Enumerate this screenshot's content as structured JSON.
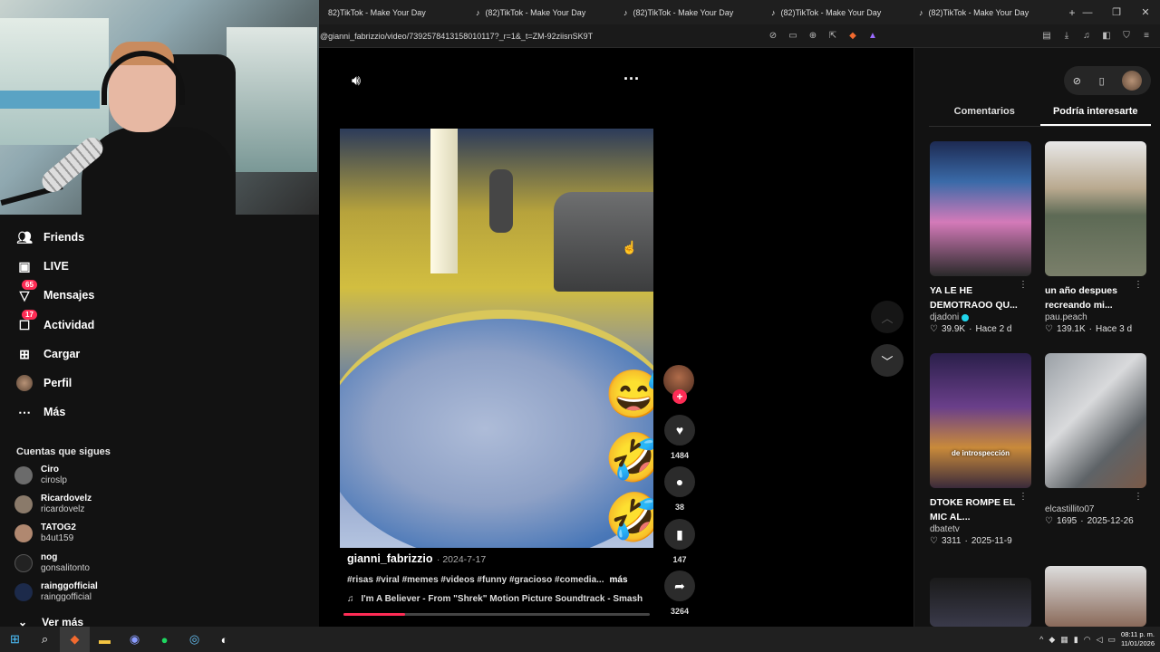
{
  "browser": {
    "tabs": [
      {
        "title": "(82)TikTok - Make Your Day",
        "display": "82)TikTok - Make Your Day"
      },
      {
        "title": "(82)TikTok - Make Your Day",
        "display": "(82)TikTok - Make Your Day"
      },
      {
        "title": "(82)TikTok - Make Your Day",
        "display": "(82)TikTok - Make Your Day"
      },
      {
        "title": "(82)TikTok - Make Your Day",
        "display": "(82)TikTok - Make Your Day"
      },
      {
        "title": "(82)TikTok - Make Your Day",
        "display": "(82)TikTok - Make Your Day"
      }
    ],
    "new_tab": "+",
    "url": "@gianni_fabrizzio/video/7392578413158010117?_r=1&_t=ZM-92ziisnSK9T"
  },
  "sidebar": {
    "items": [
      {
        "label": "Friends",
        "icon": "friends-icon",
        "badge": ""
      },
      {
        "label": "LIVE",
        "icon": "live-icon",
        "badge": ""
      },
      {
        "label": "Mensajes",
        "icon": "messages-icon",
        "badge": "65"
      },
      {
        "label": "Actividad",
        "icon": "activity-icon",
        "badge": "17"
      },
      {
        "label": "Cargar",
        "icon": "upload-icon",
        "badge": ""
      },
      {
        "label": "Perfil",
        "icon": "profile-avatar",
        "badge": ""
      },
      {
        "label": "Más",
        "icon": "more-icon",
        "badge": ""
      }
    ],
    "following_title": "Cuentas que sigues",
    "accounts": [
      {
        "name": "Ciro",
        "handle": "ciroslp",
        "color": "#6b6b6b"
      },
      {
        "name": "Ricardovelz",
        "handle": "ricardovelz",
        "color": "#8a7a6a"
      },
      {
        "name": "TATOG2",
        "handle": "b4ut159",
        "color": "#b08870"
      },
      {
        "name": "nog",
        "handle": "gonsalitonto",
        "color": "#222222"
      },
      {
        "name": "rainggofficial",
        "handle": "rainggofficial",
        "color": "#1c2a4a"
      }
    ],
    "see_more": "Ver más"
  },
  "video": {
    "username": "gianni_fabrizzio",
    "date": "· 2024-7-17",
    "hashtags": "#risas #viral #memes #videos #funny #gracioso #comedia...",
    "more": "más",
    "music": "I'm A Believer - From \"Shrek\" Motion Picture Soundtrack - Smash",
    "progress": 0.2,
    "likes": "1484",
    "comments": "38",
    "saves": "147",
    "shares": "3264",
    "emojis": [
      "😅",
      "🤣",
      "🤣"
    ]
  },
  "right_panel": {
    "tabs": [
      "Comentarios",
      "Podría interesarte"
    ],
    "active_tab": 1,
    "cards": [
      {
        "title": "YA LE HE DEMOTRAOO QU...",
        "user": "djadoni",
        "verified": true,
        "likes": "39.9K",
        "time": "Hace 2 d",
        "bg": "#3a6aa8"
      },
      {
        "title": "un año despues recreando mi...",
        "user": "pau.peach",
        "verified": false,
        "likes": "139.1K",
        "time": "Hace 3 d",
        "bg": "#8a8f7a"
      },
      {
        "title": "DTOKE ROMPE EL MIC AL...",
        "user": "dbatetv",
        "verified": false,
        "likes": "3311",
        "time": "2025-11-9",
        "bg": "#4a2f6a",
        "overlay": "de introspección"
      },
      {
        "title": "",
        "user": "elcastillito07",
        "verified": false,
        "likes": "1695",
        "time": "2025-12-26",
        "bg": "#7a7f84"
      },
      {
        "title": "",
        "user": "",
        "verified": false,
        "likes": "",
        "time": "",
        "bg": "#2a2a3a"
      },
      {
        "title": "",
        "user": "",
        "verified": false,
        "likes": "",
        "time": "",
        "bg": "#8a6a5a"
      }
    ]
  },
  "taskbar": {
    "time": "08:11 p. m.",
    "date": "11/01/2026"
  },
  "colors": {
    "accent": "#fe2c55",
    "verified": "#20d5ec"
  }
}
